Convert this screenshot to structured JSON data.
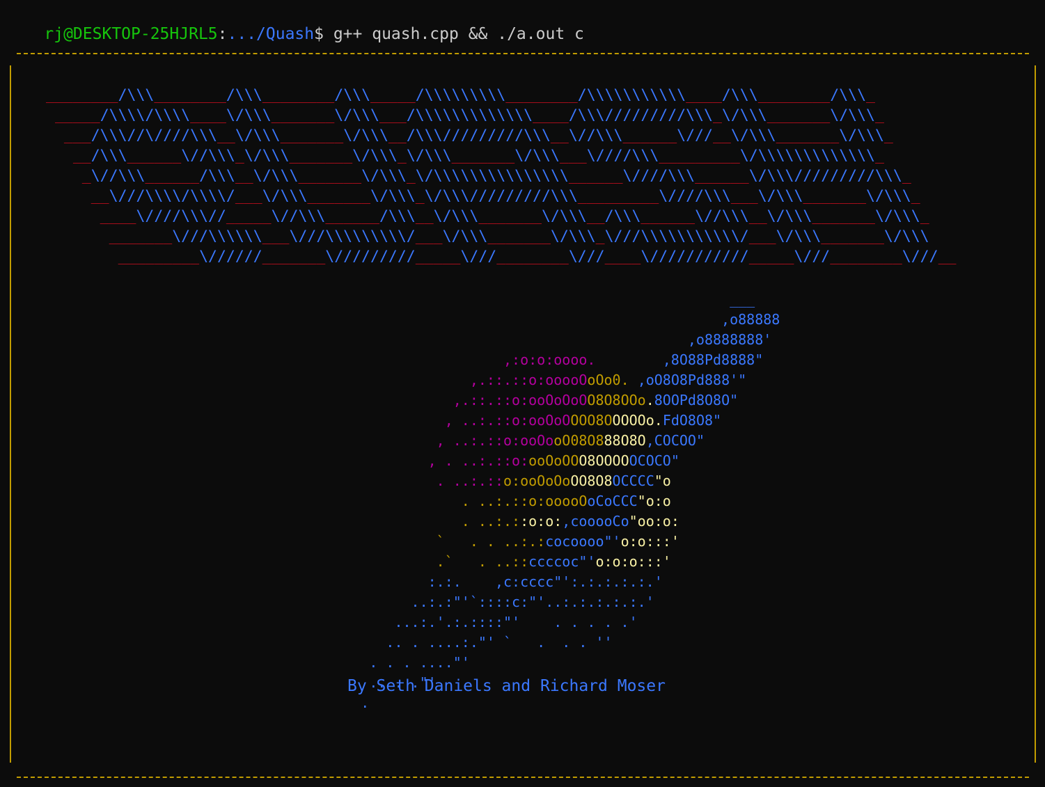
{
  "terminal": {
    "prompt_user": "rj@DESKTOP-25HJRL5",
    "prompt_sep": ":",
    "prompt_path": ".../Quash",
    "prompt_symbol": "$",
    "command": " g++ quash.cpp && ./a.out c"
  },
  "logo": {
    "lines": [
      "________/\\\\\\________/\\\\\\________/\\\\\\_____/\\\\\\\\\\\\\\\\\\________/\\\\\\\\\\\\\\\\\\\\\\____/\\\\\\________/\\\\\\_",
      " _____/\\\\\\\\/\\\\\\\\____\\/\\\\\\_______\\/\\\\\\___/\\\\\\\\\\\\\\\\\\\\\\\\\\____/\\\\\\/////////\\\\\\_\\/\\\\\\_______\\/\\\\\\_",
      "  ___/\\\\\\//\\////\\\\\\__\\/\\\\\\_______\\/\\\\\\__/\\\\\\/////////\\\\\\__\\//\\\\\\______\\///__\\/\\\\\\_______\\/\\\\\\_",
      "   __/\\\\\\______\\//\\\\\\_\\/\\\\\\_______\\/\\\\\\_\\/\\\\\\_______\\/\\\\\\___\\////\\\\\\_________\\/\\\\\\\\\\\\\\\\\\\\\\\\\\_",
      "    _\\//\\\\\\______/\\\\\\__\\/\\\\\\_______\\/\\\\\\_\\/\\\\\\\\\\\\\\\\\\\\\\\\\\\\\\______\\////\\\\\\______\\/\\\\\\/////////\\\\\\_",
      "     __\\///\\\\\\\\/\\\\\\\\/___\\/\\\\\\_______\\/\\\\\\_\\/\\\\\\/////////\\\\\\_________\\////\\\\\\___\\/\\\\\\_______\\/\\\\\\_",
      "      ____\\////\\\\\\//_____\\//\\\\\\______/\\\\\\__\\/\\\\\\_______\\/\\\\\\__/\\\\\\______\\//\\\\\\__\\/\\\\\\_______\\/\\\\\\_",
      "       _______\\///\\\\\\\\\\\\___\\///\\\\\\\\\\\\\\\\\\/___\\/\\\\\\_______\\/\\\\\\_\\///\\\\\\\\\\\\\\\\\\\\\\/___\\/\\\\\\_______\\/\\\\\\",
      "        _________\\//////_______\\/////////_____\\///________\\///____\\///////////_____\\///________\\///__"
    ]
  },
  "art": {
    "lines": [
      [
        [
          "                                                   ___",
          "b"
        ]
      ],
      [
        [
          "                                                  ,o88888",
          "b"
        ]
      ],
      [
        [
          "                                              ,o8888888'",
          "b"
        ]
      ],
      [
        [
          "                        ,:o:o:oooo.        ",
          "m"
        ],
        [
          ",8O88Pd8888\"",
          "b"
        ]
      ],
      [
        [
          "                    ,.::.::o:",
          "m"
        ],
        [
          "ooooO",
          "m"
        ],
        [
          "oO",
          "y"
        ],
        [
          "o0. ",
          "y"
        ],
        [
          ",oO8O8Pd888'\"",
          "b"
        ]
      ],
      [
        [
          "                  ,.::.::o:",
          "m"
        ],
        [
          "ooOoOoO",
          "m"
        ],
        [
          "O8O8OOo",
          "y"
        ],
        [
          ".",
          "w"
        ],
        [
          "8OOPd8O8O\"",
          "b"
        ]
      ],
      [
        [
          "                 , ..:.::o:",
          "m"
        ],
        [
          "ooOoO",
          "m"
        ],
        [
          "OOO8O",
          "y"
        ],
        [
          "OOOOo",
          "w"
        ],
        [
          ".",
          "w"
        ],
        [
          "FdO8O8\"",
          "b"
        ]
      ],
      [
        [
          "                , ..:.::o:",
          "m"
        ],
        [
          "ooOo",
          "m"
        ],
        [
          "oO08O8",
          "y"
        ],
        [
          "88O8O",
          "w"
        ],
        [
          ",COCOO\"",
          "b"
        ]
      ],
      [
        [
          "               , . ..:.::o:",
          "m"
        ],
        [
          "ooOoOO",
          "y"
        ],
        [
          "O8OOOO",
          "w"
        ],
        [
          "OCOCO\"",
          "b"
        ]
      ],
      [
        [
          "                . ..:.::",
          "m"
        ],
        [
          "o:ooOoOo",
          "y"
        ],
        [
          "OO8O8",
          "w"
        ],
        [
          "OCCCC",
          "b"
        ],
        [
          "\"o",
          "w"
        ]
      ],
      [
        [
          "                   . ..:.:",
          "y"
        ],
        [
          ":o:",
          "y"
        ],
        [
          "ooooO",
          "y"
        ],
        [
          "oCoCCC",
          "b"
        ],
        [
          "\"o:o",
          "w"
        ]
      ],
      [
        [
          "                   . ..:.:",
          "y"
        ],
        [
          ":o:o:",
          "w"
        ],
        [
          ",cooooCo",
          "b"
        ],
        [
          "\"oo:o:",
          "w"
        ]
      ],
      [
        [
          "                `   . . ..:.:",
          "y"
        ],
        [
          "cocoooo",
          "b"
        ],
        [
          "\"'",
          "b"
        ],
        [
          "o:o:::'",
          "w"
        ]
      ],
      [
        [
          "                .`   . ..::",
          "y"
        ],
        [
          "ccccoc",
          "b"
        ],
        [
          "\"'",
          "b"
        ],
        [
          "o:o:o:::'",
          "w"
        ]
      ],
      [
        [
          "               :.:.    ,c:cccc\"':.:.:.:.:.'",
          "b"
        ]
      ],
      [
        [
          "             ..:.:\"'`::::c:\"'..:.:.:.:.:.'",
          "b"
        ]
      ],
      [
        [
          "           ...:.'.:.::::\"'    . . . . .'",
          "b"
        ]
      ],
      [
        [
          "          .. . ....:.\"' `   .  . . ''",
          "b"
        ]
      ],
      [
        [
          "        . . . ....\"'",
          "b"
        ]
      ],
      [
        [
          "        .. . .\"'",
          "b"
        ]
      ],
      [
        [
          "       .",
          "b"
        ]
      ]
    ]
  },
  "credits": "By Seth Daniels and Richard Moser",
  "colors": {
    "background": "#0c0c0c",
    "green": "#16c60c",
    "blue": "#3b78ff",
    "red": "#c50f1f",
    "yellow": "#c19c00",
    "magenta": "#b4009e",
    "light_yellow": "#f9f1a5",
    "white": "#cccccc"
  }
}
